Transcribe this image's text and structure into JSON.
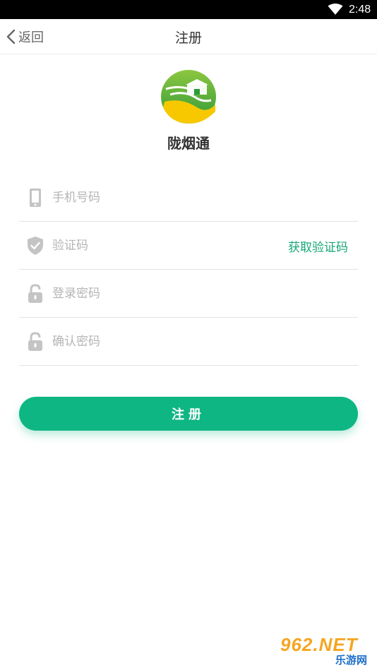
{
  "status_bar": {
    "time": "2:48",
    "wifi_icon": "wifi-icon"
  },
  "nav": {
    "back_label": "返回",
    "title": "注册",
    "back_icon": "chevron-left-icon"
  },
  "app": {
    "name": "陇烟通",
    "logo_icon": "app-logo-icon"
  },
  "form": {
    "phone": {
      "placeholder": "手机号码",
      "value": "",
      "icon": "phone-icon"
    },
    "code": {
      "placeholder": "验证码",
      "value": "",
      "icon": "shield-check-icon",
      "get_code_label": "获取验证码"
    },
    "password": {
      "placeholder": "登录密码",
      "value": "",
      "icon": "lock-icon"
    },
    "confirm_password": {
      "placeholder": "确认密码",
      "value": "",
      "icon": "lock-icon"
    },
    "submit_label": "注册"
  },
  "watermark": {
    "brand": "962.NET",
    "sub": "乐游网"
  },
  "colors": {
    "accent": "#0eb683",
    "link": "#17a777",
    "icon_gray": "#c4c4c4"
  }
}
